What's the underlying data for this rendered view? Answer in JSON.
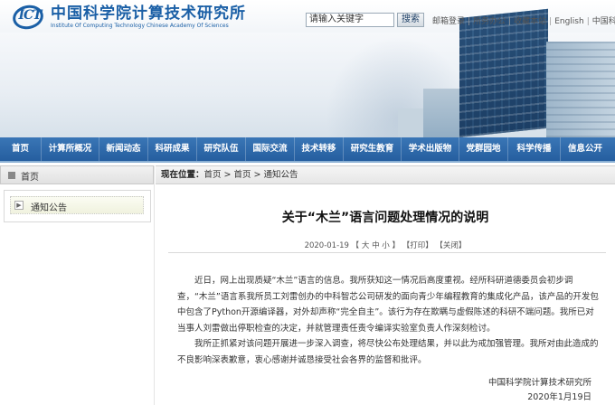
{
  "header": {
    "logo_mark": "ICT",
    "logo_cn": "中国科学院计算技术研究所",
    "logo_en": "Institute Of Computing Technology Chinese Academy Of Sciences",
    "search_value": "请输入关键字",
    "search_button": "搜索",
    "links": [
      "邮箱登录",
      "所务办公",
      "收藏本站",
      "English",
      "中国科学院"
    ]
  },
  "nav": {
    "items": [
      "首页",
      "计算所概况",
      "新闻动态",
      "科研成果",
      "研究队伍",
      "国际交流",
      "技术转移",
      "研究生教育",
      "学术出版物",
      "党群园地",
      "科学传播",
      "信息公开"
    ]
  },
  "sidebar": {
    "title": "首页",
    "item": "通知公告"
  },
  "breadcrumb": {
    "label": "现在位置：",
    "path": "首页 > 首页 > 通知公告"
  },
  "article": {
    "title": "关于“木兰”语言问题处理情况的说明",
    "date": "2020-01-19",
    "font_size": "【 大 中 小 】",
    "print": "【打印】",
    "close": "【关闭】",
    "paragraphs": [
      "近日，网上出现质疑“木兰”语言的信息。我所获知这一情况后高度重视。经所科研道德委员会初步调查，“木兰”语言系我所员工刘雷创办的中科智芯公司研发的面向青少年编程教育的集成化产品，该产品的开发包中包含了Python开源编译器，对外却声称“完全自主”。该行为存在欺瞒与虚假陈述的科研不端问题。我所已对当事人刘雷做出停职检查的决定，并就管理责任责令编译实验室负责人作深刻检讨。",
      "我所正抓紧对该问题开展进一步深入调查，将尽快公布处理结果，并以此为戒加强管理。我所对由此造成的不良影响深表歉意，衷心感谢并诚恳接受社会各界的监督和批评。"
    ],
    "signature": "中国科学院计算技术研究所",
    "sign_date": "2020年1月19日"
  }
}
